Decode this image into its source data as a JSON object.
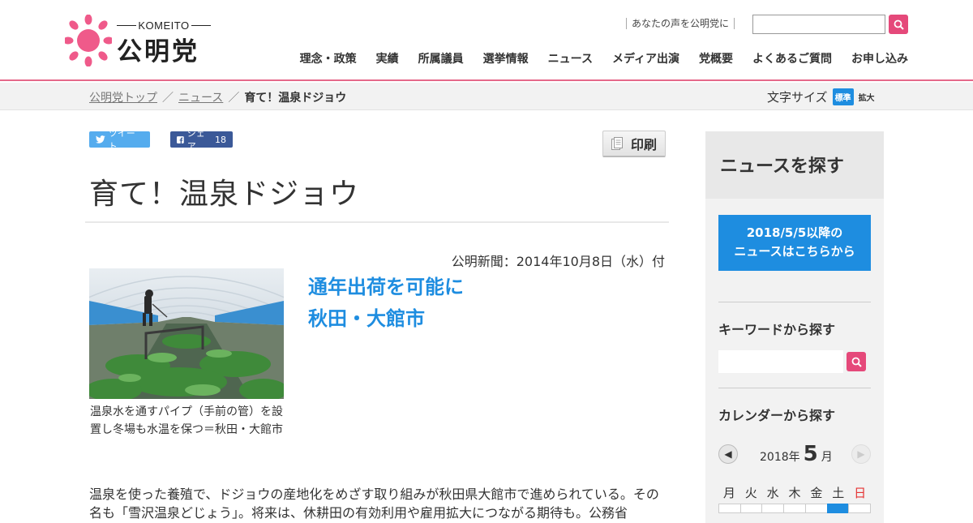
{
  "header": {
    "logo_small": "KOMEITO",
    "logo_main": "公明党",
    "voice_link": "あなたの声を公明党に",
    "search_placeholder": "",
    "nav": [
      "理念・政策",
      "実績",
      "所属議員",
      "選挙情報",
      "ニュース",
      "メディア出演",
      "党概要",
      "よくあるご質問",
      "お申し込み"
    ],
    "accent_color": "#e5497a"
  },
  "breadcrumb": {
    "items": [
      "公明党トップ",
      "ニュース"
    ],
    "current": "育て！温泉ドジョウ",
    "separator": "／"
  },
  "fontsize": {
    "label": "文字サイズ",
    "standard": "標準",
    "large": "拡大"
  },
  "share": {
    "tweet": "ツイート",
    "fb_share": "シェア",
    "fb_count": "18"
  },
  "print_label": "印刷",
  "article": {
    "title": "育て！温泉ドジョウ",
    "pubdate": "公明新聞：2014年10月8日（水）付",
    "subhead_1": "通年出荷を可能に",
    "subhead_2": "秋田・大館市",
    "caption": "温泉水を通すパイプ（手前の管）を設置し冬場も水温を保つ＝秋田・大館市",
    "body": "温泉を使った養殖で、ドジョウの産地化をめざす取り組みが秋田県大館市で進められている。その名も「雪沢温泉どじょう」。将来は、休耕田の有効利用や雇用拡大につながる期待も。公務省"
  },
  "sidebar": {
    "heading": "ニュースを探す",
    "banner_1": "2018/5/5以降の",
    "banner_2": "ニュースはこちらから",
    "keyword_label": "キーワードから探す",
    "calendar_label": "カレンダーから探す",
    "calendar": {
      "year_text": "2018年",
      "month": "5",
      "month_suffix": "月",
      "weekdays": [
        "月",
        "火",
        "水",
        "木",
        "金",
        "土",
        "日"
      ]
    }
  }
}
